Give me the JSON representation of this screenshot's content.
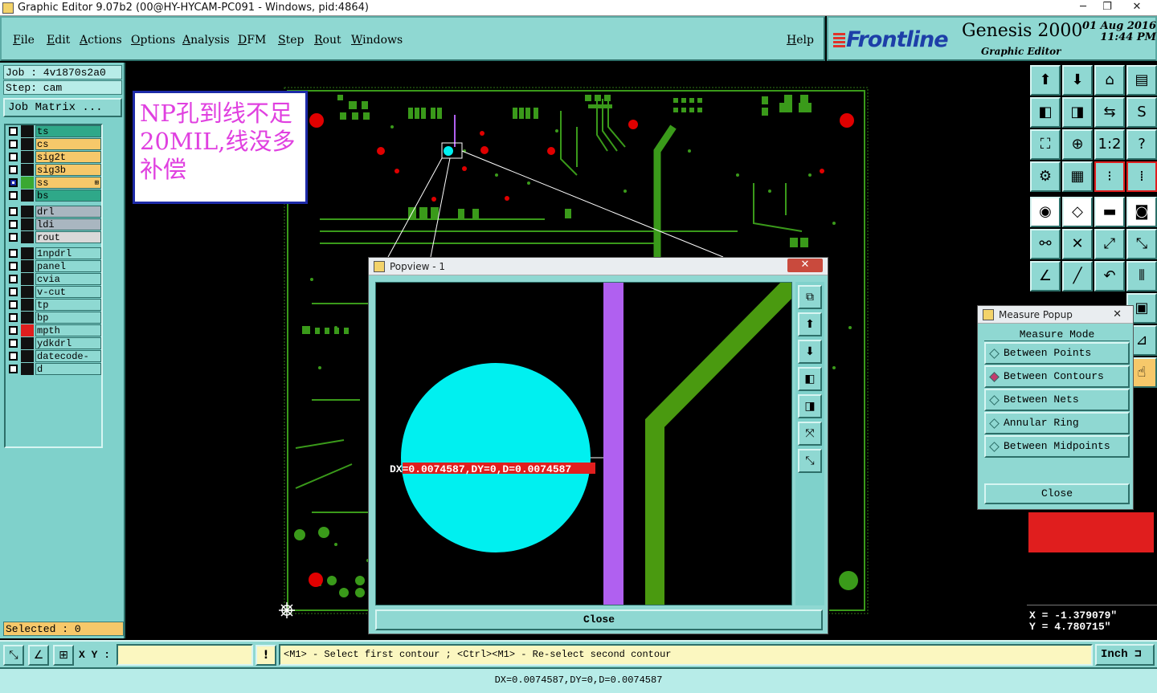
{
  "window": {
    "title": "Graphic Editor 9.07b2 (00@HY-HYCAM-PC091 - Windows, pid:4864)",
    "minimize": "─",
    "restore": "❐",
    "close": "✕"
  },
  "menu": [
    "File",
    "Edit",
    "Actions",
    "Options",
    "Analysis",
    "DFM",
    "Step",
    "Rout",
    "Windows"
  ],
  "help": "Help",
  "brand": {
    "logo": "Frontline",
    "product": "Genesis 2000",
    "subtitle": "Graphic Editor",
    "date": "01 Aug 2016",
    "time": "11:44 PM"
  },
  "job": "Job : 4v1870s2a0",
  "step": "Step: cam",
  "job_matrix": "Job Matrix ...",
  "layers": [
    {
      "name": "ts",
      "kind": "board",
      "swatch": "#111111",
      "checked": false
    },
    {
      "name": "cs",
      "kind": "signal",
      "swatch": "#111111",
      "checked": false
    },
    {
      "name": "sig2t",
      "kind": "signal",
      "swatch": "#111111",
      "checked": false
    },
    {
      "name": "sig3b",
      "kind": "signal",
      "swatch": "#111111",
      "checked": false
    },
    {
      "name": "ss",
      "kind": "signal",
      "swatch": "#3aa832",
      "checked": true,
      "marker": "⊞"
    },
    {
      "name": "bs",
      "kind": "board",
      "swatch": "#111111",
      "checked": false
    },
    {
      "name": "drl",
      "kind": "drill",
      "swatch": "#111111",
      "checked": false
    },
    {
      "name": "ldi",
      "kind": "drill",
      "swatch": "#111111",
      "checked": false
    },
    {
      "name": "rout",
      "kind": "rout",
      "swatch": "#111111",
      "checked": false
    },
    {
      "name": "1npdrl",
      "kind": "misc",
      "swatch": "#111111",
      "checked": false
    },
    {
      "name": "panel",
      "kind": "misc",
      "swatch": "#111111",
      "checked": false
    },
    {
      "name": "cvia",
      "kind": "misc",
      "swatch": "#111111",
      "checked": false
    },
    {
      "name": "v-cut",
      "kind": "misc",
      "swatch": "#111111",
      "checked": false
    },
    {
      "name": "tp",
      "kind": "misc",
      "swatch": "#111111",
      "checked": false
    },
    {
      "name": "bp",
      "kind": "misc",
      "swatch": "#111111",
      "checked": false
    },
    {
      "name": "mpth",
      "kind": "misc",
      "swatch": "#e01e1e",
      "checked": false
    },
    {
      "name": "ydkdrl",
      "kind": "misc",
      "swatch": "#111111",
      "checked": false
    },
    {
      "name": "datecode-ts",
      "kind": "misc",
      "swatch": "#111111",
      "checked": false
    },
    {
      "name": "d",
      "kind": "misc",
      "swatch": "#111111",
      "checked": false
    }
  ],
  "selected": "Selected : 0",
  "note": "NP孔到线不足20MIL,线没多补偿",
  "colors": {
    "trace_green": "#3a9a1a",
    "pad_red": "#e00000",
    "hole_cyan": "#00f0f0",
    "line_purple": "#b060f0",
    "ui_teal": "#8fd8d2"
  },
  "popview": {
    "title": "Popview - 1",
    "close_x": "✕",
    "measure_text": "DX=0.0074587,DY=0,D=0.0074587",
    "close": "Close",
    "tools": [
      "zoom-fit-icon",
      "pan-up-icon",
      "pan-down-icon",
      "pan-left-icon",
      "pan-right-icon",
      "zoom-in-icon",
      "zoom-out-icon"
    ]
  },
  "measure": {
    "title": "Measure Popup",
    "close_x": "✕",
    "mode_label": "Measure Mode",
    "options": [
      {
        "label": "Between Points",
        "selected": false
      },
      {
        "label": "Between Contours",
        "selected": true
      },
      {
        "label": "Between Nets",
        "selected": false
      },
      {
        "label": "Annular Ring",
        "selected": false
      },
      {
        "label": "Between Midpoints",
        "selected": false
      }
    ],
    "close": "Close"
  },
  "coords": {
    "x": "X = -1.379079\"",
    "y": "Y =  4.780715\""
  },
  "bottom": {
    "xy_label": "X Y :",
    "xy_value": "",
    "excl": "!",
    "prompt": "<M1> - Select first contour ; <Ctrl><M1> - Re-select second contour",
    "units": "Inch",
    "status": "DX=0.0074587,DY=0,D=0.0074587"
  }
}
